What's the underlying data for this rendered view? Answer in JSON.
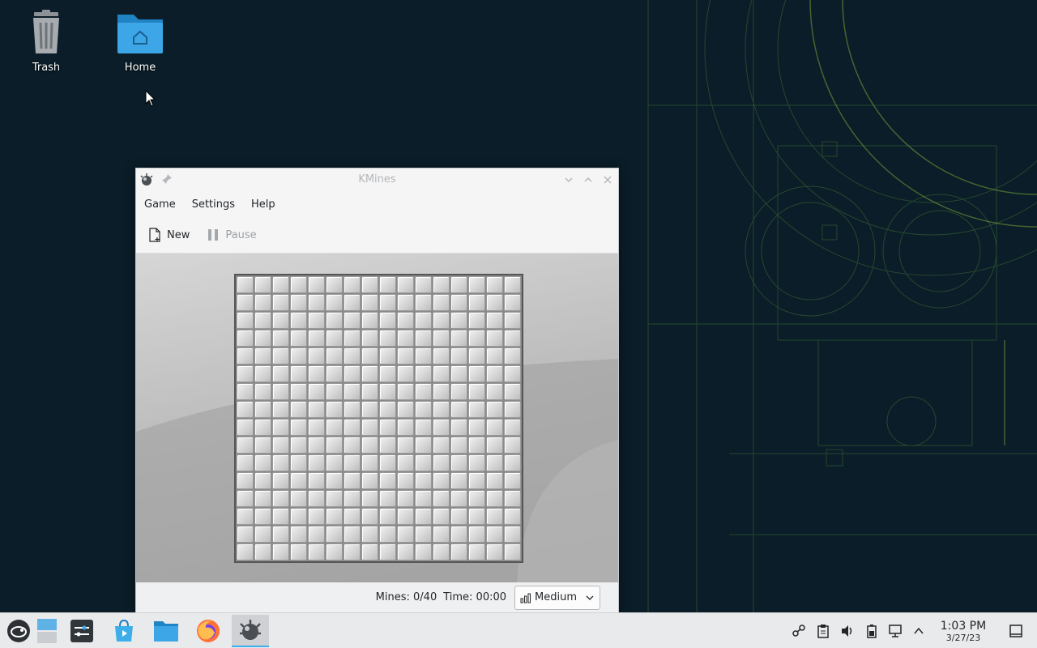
{
  "desktop": {
    "icons": [
      {
        "label": "Trash",
        "icon": "trash-icon"
      },
      {
        "label": "Home",
        "icon": "home-folder-icon"
      }
    ]
  },
  "window": {
    "title": "KMines",
    "menu": [
      "Game",
      "Settings",
      "Help"
    ],
    "toolbar": {
      "new_label": "New",
      "pause_label": "Pause"
    },
    "board": {
      "columns": 16,
      "rows": 16
    },
    "status": {
      "mines": "Mines: 0/40",
      "time": "Time: 00:00",
      "difficulty": "Medium"
    }
  },
  "taskbar": {
    "items": [
      "app-launcher-icon",
      "desktop-pager-icon",
      "system-settings-icon",
      "discover-icon",
      "dolphin-icon",
      "firefox-icon",
      "kmines-icon"
    ],
    "tray": [
      "kde-connect-icon",
      "clipboard-icon",
      "volume-icon",
      "battery-icon",
      "network-icon",
      "show-hidden-icon"
    ],
    "clock": {
      "time": "1:03 PM",
      "date": "3/27/23"
    }
  },
  "colors": {
    "accent": "#3daee9",
    "folder": "#3da6e6",
    "wallpaper_bg": "#0a1d28",
    "wallpaper_lines": "#4b7a3e"
  }
}
